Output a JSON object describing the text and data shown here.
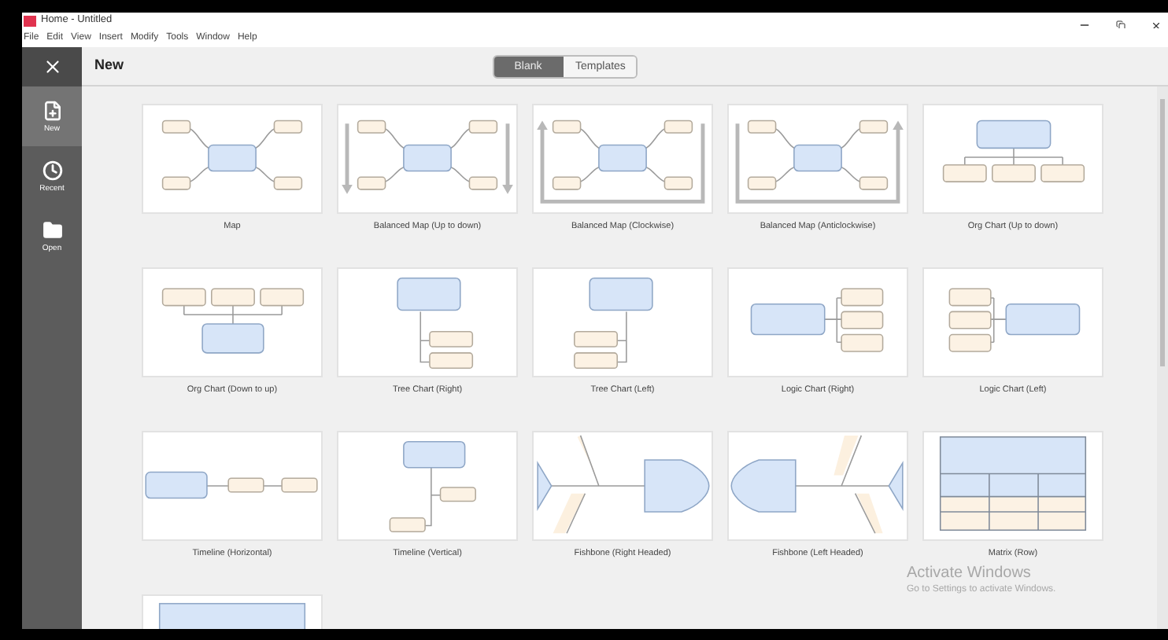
{
  "window": {
    "title": "Home - Untitled"
  },
  "menu": [
    "File",
    "Edit",
    "View",
    "Insert",
    "Modify",
    "Tools",
    "Window",
    "Help"
  ],
  "sidebar": {
    "items": [
      {
        "label": "New",
        "kind": "new",
        "selected": true
      },
      {
        "label": "Recent",
        "kind": "recent",
        "selected": false
      },
      {
        "label": "Open",
        "kind": "open",
        "selected": false
      }
    ]
  },
  "header": {
    "title": "New",
    "tabs": [
      {
        "label": "Blank",
        "selected": true
      },
      {
        "label": "Templates",
        "selected": false
      }
    ]
  },
  "templates": [
    {
      "label": "Map",
      "kind": "map"
    },
    {
      "label": "Balanced Map (Up to down)",
      "kind": "balanced-down"
    },
    {
      "label": "Balanced Map (Clockwise)",
      "kind": "balanced-cw"
    },
    {
      "label": "Balanced Map (Anticlockwise)",
      "kind": "balanced-acw"
    },
    {
      "label": "Org Chart (Up to down)",
      "kind": "org-down"
    },
    {
      "label": "Org Chart (Down to up)",
      "kind": "org-up"
    },
    {
      "label": "Tree Chart (Right)",
      "kind": "tree-right"
    },
    {
      "label": "Tree Chart (Left)",
      "kind": "tree-left"
    },
    {
      "label": "Logic Chart (Right)",
      "kind": "logic-right"
    },
    {
      "label": "Logic Chart (Left)",
      "kind": "logic-left"
    },
    {
      "label": "Timeline (Horizontal)",
      "kind": "timeline-h"
    },
    {
      "label": "Timeline (Vertical)",
      "kind": "timeline-v"
    },
    {
      "label": "Fishbone (Right Headed)",
      "kind": "fishbone-right"
    },
    {
      "label": "Fishbone (Left Headed)",
      "kind": "fishbone-left"
    },
    {
      "label": "Matrix (Row)",
      "kind": "matrix-row"
    },
    {
      "kind": "partial"
    }
  ],
  "os_notice": {
    "title": "Activate Windows",
    "text": "Go to Settings to activate Windows."
  }
}
